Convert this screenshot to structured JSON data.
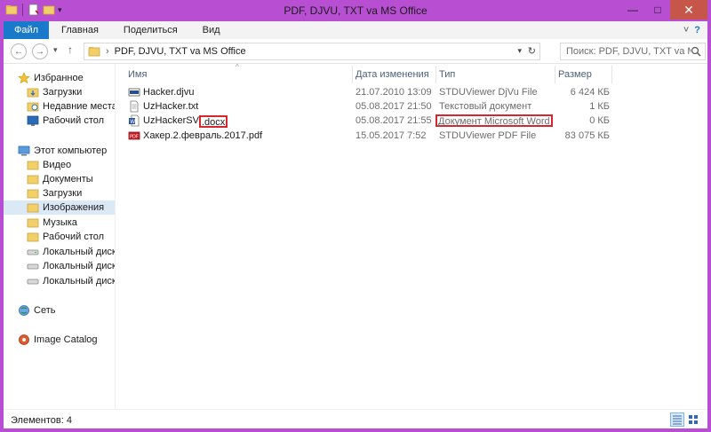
{
  "window": {
    "title": "PDF, DJVU, TXT va MS Office",
    "minimize": "—",
    "maximize": "□",
    "close": "✕"
  },
  "ribbon": {
    "tabs": [
      "Файл",
      "Главная",
      "Поделиться",
      "Вид"
    ],
    "expand": "˅",
    "help": "?"
  },
  "nav": {
    "back": "←",
    "forward": "→",
    "history": "▾",
    "up": "↑",
    "separator": "›",
    "path": "PDF, DJVU, TXT va MS Office",
    "dropdown": "▾",
    "refresh": "↻",
    "search_placeholder": "Поиск: PDF, DJVU, TXT va MS..."
  },
  "sidebar": {
    "items": [
      {
        "label": "Избранное",
        "icon": "star-icon",
        "level": 0
      },
      {
        "label": "Загрузки",
        "icon": "folder-icon",
        "level": 1
      },
      {
        "label": "Недавние места",
        "icon": "recent-places-icon",
        "level": 1
      },
      {
        "label": "Рабочий стол",
        "icon": "desktop-icon",
        "level": 1
      },
      {
        "label": "Этот компьютер",
        "icon": "computer-icon",
        "level": 0
      },
      {
        "label": "Видео",
        "icon": "folder-icon",
        "level": 1
      },
      {
        "label": "Документы",
        "icon": "folder-icon",
        "level": 1
      },
      {
        "label": "Загрузки",
        "icon": "folder-icon",
        "level": 1
      },
      {
        "label": "Изображения",
        "icon": "folder-icon",
        "level": 1
      },
      {
        "label": "Музыка",
        "icon": "folder-icon",
        "level": 1
      },
      {
        "label": "Рабочий стол",
        "icon": "folder-icon",
        "level": 1
      },
      {
        "label": "Локальный диск (C",
        "icon": "drive-icon",
        "level": 1
      },
      {
        "label": "Локальный диск (D",
        "icon": "drive-icon",
        "level": 1
      },
      {
        "label": "Локальный диск (E:",
        "icon": "drive-icon",
        "level": 1
      },
      {
        "label": "Сеть",
        "icon": "network-icon",
        "level": 0
      },
      {
        "label": "Image Catalog",
        "icon": "image-catalog-icon",
        "level": 0
      }
    ],
    "selected": "Изображения"
  },
  "filelist": {
    "columns": [
      "Имя",
      "Дата изменения",
      "Тип",
      "Размер"
    ],
    "sort_indicator": "^",
    "rows": [
      {
        "name": "Hacker.djvu",
        "date": "21.07.2010 13:09",
        "type": "STDUViewer DjVu File",
        "size": "6 424 КБ",
        "icon": "djvu-file-icon"
      },
      {
        "name": "UzHacker.txt",
        "date": "05.08.2017 21:50",
        "type": "Текстовый документ",
        "size": "1 КБ",
        "icon": "txt-file-icon"
      },
      {
        "name_prefix": "UzHackerSV",
        "name_highlight": ".docx",
        "date": "05.08.2017 21:55",
        "type": "Документ Microsoft Word",
        "size": "0 КБ",
        "icon": "word-file-icon"
      },
      {
        "name": "Хакер.2.февраль.2017.pdf",
        "date": "15.05.2017 7:52",
        "type": "STDUViewer PDF File",
        "size": "83 075 КБ",
        "icon": "pdf-file-icon"
      }
    ]
  },
  "status": {
    "items_count": "Элементов: 4"
  },
  "colors": {
    "accent": "#b84fd3",
    "file_tab": "#1979ca",
    "highlight": "#d8262e",
    "close": "#c6564a"
  }
}
